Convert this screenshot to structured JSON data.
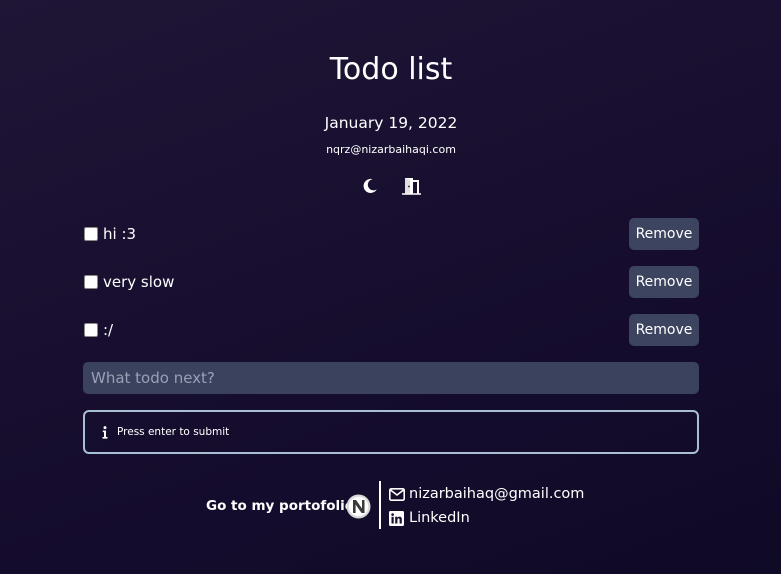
{
  "app": {
    "title": "Todo list",
    "date": "January 19, 2022",
    "user_email": "nqrz@nizarbaihaqi.com"
  },
  "toolbar": {
    "theme_icon": "moon-icon",
    "logout_icon": "door-exit-icon"
  },
  "todos": [
    {
      "label": "hi :3",
      "checked": false,
      "remove_label": "Remove"
    },
    {
      "label": "very slow",
      "checked": false,
      "remove_label": "Remove"
    },
    {
      "label": ":/",
      "checked": false,
      "remove_label": "Remove"
    }
  ],
  "input": {
    "placeholder": "What todo next?",
    "value": ""
  },
  "hint": {
    "icon": "info-icon",
    "text": "Press enter to submit"
  },
  "footer": {
    "portfolio_label": "Go to my portofolio",
    "logo_icon": "n-logo-icon",
    "email_label": "nizarbaihaq@gmail.com",
    "email_icon": "envelope-icon",
    "linkedin_label": "LinkedIn",
    "linkedin_icon": "linkedin-icon"
  },
  "colors": {
    "background": "#1a1030",
    "button_bg": "#3d4460",
    "input_bg": "#3b425e",
    "hint_border": "#a8c0d4"
  }
}
